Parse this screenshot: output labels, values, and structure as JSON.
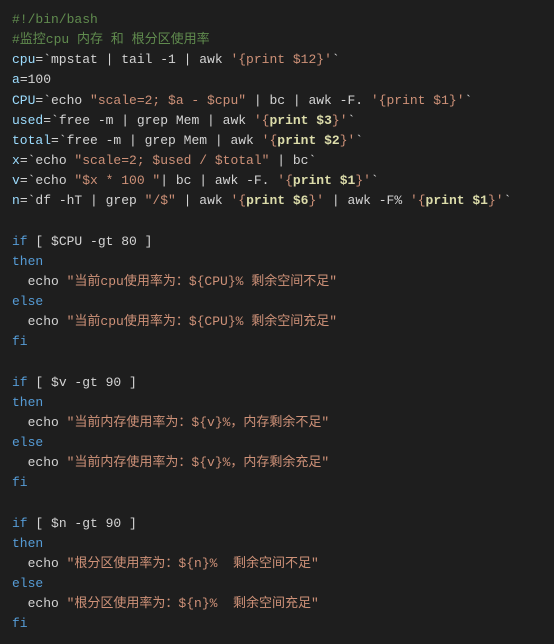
{
  "code": {
    "lines": [
      {
        "id": "line1",
        "parts": [
          {
            "text": "#!/bin/bash",
            "class": "shebang"
          }
        ]
      },
      {
        "id": "line2",
        "parts": [
          {
            "text": "#监控cpu 内存 和 根分区使用率",
            "class": "comment"
          }
        ]
      },
      {
        "id": "line3",
        "parts": [
          {
            "text": "cpu",
            "class": "variable"
          },
          {
            "text": "=`mpstat | tail -1 | awk '{print $12}'`",
            "class": "plain"
          }
        ]
      },
      {
        "id": "line4",
        "parts": [
          {
            "text": "a",
            "class": "variable"
          },
          {
            "text": "=100",
            "class": "plain"
          }
        ]
      },
      {
        "id": "line5",
        "parts": [
          {
            "text": "CPU",
            "class": "variable"
          },
          {
            "text": "=`echo \"scale=2; $a - $cpu\" | bc | awk -F. '{print $1}'`",
            "class": "plain"
          }
        ]
      },
      {
        "id": "line6",
        "parts": [
          {
            "text": "used",
            "class": "variable"
          },
          {
            "text": "=`free -m | grep Mem | awk '{",
            "class": "plain"
          },
          {
            "text": "print $3",
            "class": "highlight-print"
          },
          {
            "text": "}'`",
            "class": "plain"
          }
        ]
      },
      {
        "id": "line7",
        "parts": [
          {
            "text": "total",
            "class": "variable"
          },
          {
            "text": "=`free -m | grep Mem | awk '{",
            "class": "plain"
          },
          {
            "text": "print $2",
            "class": "highlight-print"
          },
          {
            "text": "}'`",
            "class": "plain"
          }
        ]
      },
      {
        "id": "line8",
        "parts": [
          {
            "text": "x",
            "class": "variable"
          },
          {
            "text": "=`echo \"scale=2; $used / $total\" | bc`",
            "class": "plain"
          }
        ]
      },
      {
        "id": "line9",
        "parts": [
          {
            "text": "v",
            "class": "variable"
          },
          {
            "text": "=`echo \"$x * 100 \"| bc | awk -F. '{",
            "class": "plain"
          },
          {
            "text": "print $1",
            "class": "highlight-print"
          },
          {
            "text": "}'`",
            "class": "plain"
          }
        ]
      },
      {
        "id": "line10",
        "parts": [
          {
            "text": "n",
            "class": "variable"
          },
          {
            "text": "=`df -hT | grep \"/$\" | awk '{",
            "class": "plain"
          },
          {
            "text": "print $6",
            "class": "highlight-print"
          },
          {
            "text": "}' | awk -F% '{",
            "class": "plain"
          },
          {
            "text": "print $1",
            "class": "highlight-print"
          },
          {
            "text": "}'`",
            "class": "plain"
          }
        ]
      },
      {
        "id": "line11",
        "parts": [
          {
            "text": "",
            "class": "plain"
          }
        ]
      },
      {
        "id": "line12",
        "parts": [
          {
            "text": "if",
            "class": "keyword"
          },
          {
            "text": " [ $CPU -gt 80 ]",
            "class": "plain"
          }
        ]
      },
      {
        "id": "line13",
        "parts": [
          {
            "text": "then",
            "class": "keyword"
          }
        ]
      },
      {
        "id": "line14",
        "parts": [
          {
            "text": "  echo \"当前cpu使用率为：${CPU}% 剩余空间不足\"",
            "class": "plain"
          }
        ]
      },
      {
        "id": "line15",
        "parts": [
          {
            "text": "else",
            "class": "keyword"
          }
        ]
      },
      {
        "id": "line16",
        "parts": [
          {
            "text": "  echo \"当前cpu使用率为：${CPU}% 剩余空间充足\"",
            "class": "plain"
          }
        ]
      },
      {
        "id": "line17",
        "parts": [
          {
            "text": "fi",
            "class": "keyword"
          }
        ]
      },
      {
        "id": "line18",
        "parts": [
          {
            "text": "",
            "class": "plain"
          }
        ]
      },
      {
        "id": "line19",
        "parts": [
          {
            "text": "if",
            "class": "keyword"
          },
          {
            "text": " [ $v -gt 90 ]",
            "class": "plain"
          }
        ]
      },
      {
        "id": "line20",
        "parts": [
          {
            "text": "then",
            "class": "keyword"
          }
        ]
      },
      {
        "id": "line21",
        "parts": [
          {
            "text": "  echo \"当前内存使用率为：${v}%，内存剩余不足\"",
            "class": "plain"
          }
        ]
      },
      {
        "id": "line22",
        "parts": [
          {
            "text": "else",
            "class": "keyword"
          }
        ]
      },
      {
        "id": "line23",
        "parts": [
          {
            "text": "  echo \"当前内存使用率为：${v}%，内存剩余充足\"",
            "class": "plain"
          }
        ]
      },
      {
        "id": "line24",
        "parts": [
          {
            "text": "fi",
            "class": "keyword"
          }
        ]
      },
      {
        "id": "line25",
        "parts": [
          {
            "text": "",
            "class": "plain"
          }
        ]
      },
      {
        "id": "line26",
        "parts": [
          {
            "text": "if",
            "class": "keyword"
          },
          {
            "text": " [ $n -gt 90 ]",
            "class": "plain"
          }
        ]
      },
      {
        "id": "line27",
        "parts": [
          {
            "text": "then",
            "class": "keyword"
          }
        ]
      },
      {
        "id": "line28",
        "parts": [
          {
            "text": "  echo \"根分区使用率为：${n}%  剩余空间不足\"",
            "class": "plain"
          }
        ]
      },
      {
        "id": "line29",
        "parts": [
          {
            "text": "else",
            "class": "keyword"
          }
        ]
      },
      {
        "id": "line30",
        "parts": [
          {
            "text": "  echo \"根分区使用率为：${n}%  剩余空间充足\"",
            "class": "plain"
          }
        ]
      },
      {
        "id": "line31",
        "parts": [
          {
            "text": "fi",
            "class": "keyword"
          }
        ]
      }
    ]
  }
}
